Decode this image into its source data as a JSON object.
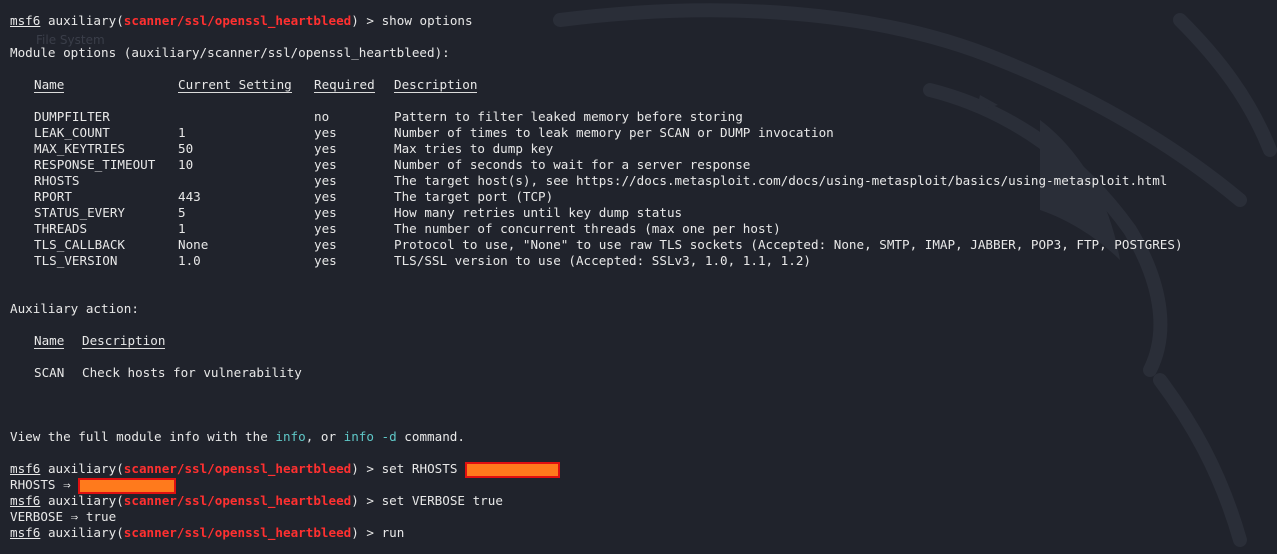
{
  "prompt": {
    "label": "msf6",
    "aux": "auxiliary",
    "module": "scanner/ssl/openssl_heartbleed"
  },
  "ghost_text": "File System",
  "commands": {
    "show": " > show options",
    "set_rhosts": " > set RHOSTS ",
    "set_verbose": " > set VERBOSE true",
    "run": " > run"
  },
  "module_options_title": "Module options (auxiliary/scanner/ssl/openssl_heartbleed):",
  "options_headers": {
    "name": "Name",
    "current": "Current Setting",
    "required": "Required",
    "description": "Description"
  },
  "options": [
    {
      "name": "DUMPFILTER",
      "current": "",
      "required": "no",
      "description": "Pattern to filter leaked memory before storing"
    },
    {
      "name": "LEAK_COUNT",
      "current": "1",
      "required": "yes",
      "description": "Number of times to leak memory per SCAN or DUMP invocation"
    },
    {
      "name": "MAX_KEYTRIES",
      "current": "50",
      "required": "yes",
      "description": "Max tries to dump key"
    },
    {
      "name": "RESPONSE_TIMEOUT",
      "current": "10",
      "required": "yes",
      "description": "Number of seconds to wait for a server response"
    },
    {
      "name": "RHOSTS",
      "current": "",
      "required": "yes",
      "description": "The target host(s), see https://docs.metasploit.com/docs/using-metasploit/basics/using-metasploit.html"
    },
    {
      "name": "RPORT",
      "current": "443",
      "required": "yes",
      "description": "The target port (TCP)"
    },
    {
      "name": "STATUS_EVERY",
      "current": "5",
      "required": "yes",
      "description": "How many retries until key dump status"
    },
    {
      "name": "THREADS",
      "current": "1",
      "required": "yes",
      "description": "The number of concurrent threads (max one per host)"
    },
    {
      "name": "TLS_CALLBACK",
      "current": "None",
      "required": "yes",
      "description": "Protocol to use, \"None\" to use raw TLS sockets (Accepted: None, SMTP, IMAP, JABBER, POP3, FTP, POSTGRES)"
    },
    {
      "name": "TLS_VERSION",
      "current": "1.0",
      "required": "yes",
      "description": "TLS/SSL version to use (Accepted: SSLv3, 1.0, 1.1, 1.2)"
    }
  ],
  "aux_action_title": "Auxiliary action:",
  "action_headers": {
    "name": "Name",
    "description": "Description"
  },
  "actions": [
    {
      "name": "SCAN",
      "description": "Check hosts for vulnerability"
    }
  ],
  "info_line": {
    "pre": "View the full module info with the ",
    "info": "info",
    "mid": ", or ",
    "info_d": "info -d",
    "post": " command."
  },
  "rhosts_echo": "RHOSTS ⇒ ",
  "verbose_echo": "VERBOSE ⇒ true",
  "colors": {
    "background": "#20232c",
    "module_red": "#ff3030",
    "cyan": "#5fc8c8",
    "redact_fill": "#ff7a1c",
    "redact_border": "#e01010"
  }
}
